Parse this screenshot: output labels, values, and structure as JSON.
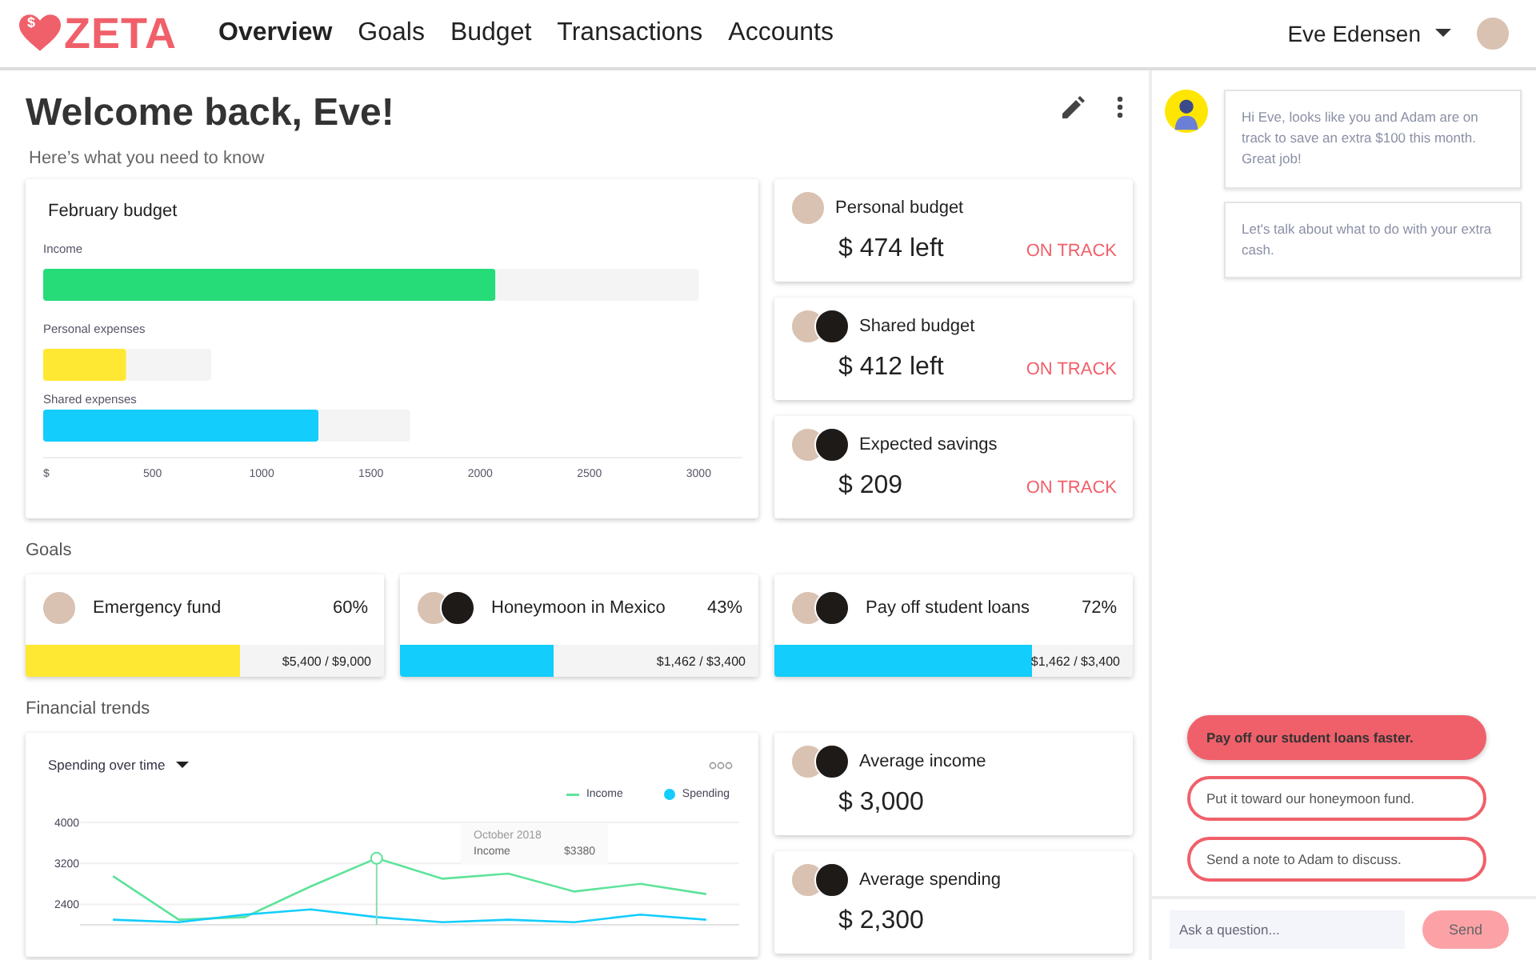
{
  "header": {
    "logo": {
      "badge": "$",
      "name": "ZETA"
    },
    "tabs": [
      {
        "label": "Overview",
        "selected": true
      },
      {
        "label": "Goals",
        "selected": false
      },
      {
        "label": "Budget",
        "selected": false
      },
      {
        "label": "Transactions",
        "selected": false
      },
      {
        "label": "Accounts",
        "selected": false
      }
    ],
    "user": {
      "name": "Eve Edensen"
    }
  },
  "welcome": {
    "title": "Welcome back, Eve!",
    "subtitle": "Here’s what you need to know"
  },
  "budget": {
    "title": "February budget",
    "chart_data": {
      "type": "bar",
      "orientation": "horizontal",
      "stacked": true,
      "series": [
        {
          "name": "Income",
          "color": "#25dc78",
          "values": [
            2070,
            null,
            null
          ]
        },
        {
          "name": "Personal expenses",
          "color": "#ffe833",
          "values": [
            null,
            380,
            null
          ]
        },
        {
          "name": "Shared expenses",
          "color": "#13cdfc",
          "values": [
            null,
            null,
            1260
          ]
        },
        {
          "color": "#f4f4f4",
          "values": [
            930,
            390,
            420
          ]
        }
      ],
      "xlim": [
        0,
        3200
      ],
      "xticks": [
        {
          "value": 0,
          "label": "$"
        },
        500,
        1000,
        1500,
        2000,
        2500,
        3000
      ]
    }
  },
  "summaries": [
    {
      "avatars": [
        {
          "kind": "light"
        }
      ],
      "title": "Personal budget",
      "amount": "$ 474 left",
      "status": "ON TRACK"
    },
    {
      "avatars": [
        {
          "kind": "light"
        },
        {
          "kind": "dark"
        }
      ],
      "title": "Shared budget",
      "amount": "$ 412 left",
      "status": "ON TRACK"
    },
    {
      "avatars": [
        {
          "kind": "light"
        },
        {
          "kind": "dark"
        }
      ],
      "title": "Expected savings",
      "amount": "$ 209",
      "status": "ON TRACK"
    }
  ],
  "goals": {
    "heading": "Goals",
    "items": [
      {
        "avatars": [
          {
            "kind": "light"
          }
        ],
        "title": "Emergency fund",
        "percent": "60%",
        "level": 0.6,
        "color": "#ffe833",
        "amount": "$5,400 / $9,000"
      },
      {
        "avatars": [
          {
            "kind": "light"
          },
          {
            "kind": "dark"
          }
        ],
        "title": "Honeymoon in Mexico",
        "percent": "43%",
        "level": 0.43,
        "color": "#13cdfc",
        "amount": "$1,462 / $3,400"
      },
      {
        "avatars": [
          {
            "kind": "light"
          },
          {
            "kind": "dark"
          }
        ],
        "title": "Pay off student loans",
        "percent": "72%",
        "level": 0.72,
        "color": "#13cdfc",
        "amount": "$1,462 / $3,400"
      }
    ]
  },
  "trends": {
    "heading": "Financial trends",
    "chart": {
      "title": "Spending over time",
      "chart_data": {
        "type": "line",
        "grid": true,
        "series": [
          {
            "name": "Income",
            "color": "#5ee39a",
            "values": [
              2950,
              2100,
              2150,
              2750,
              3300,
              2900,
              3000,
              2650,
              2800,
              2600
            ]
          },
          {
            "name": "Spending",
            "color": "#13cdfc",
            "values": [
              2100,
              2050,
              2200,
              2300,
              2150,
              2050,
              2100,
              2050,
              2200,
              2100
            ]
          }
        ],
        "ylim": [
          2000,
          4000
        ],
        "yticks": [
          2400,
          3200,
          4000
        ]
      },
      "tooltip": {
        "title": "October 2018",
        "label": "Income",
        "value": "$3380"
      }
    },
    "summaries": [
      {
        "avatars": [
          {
            "kind": "light"
          },
          {
            "kind": "dark"
          }
        ],
        "title": "Average income",
        "amount": "$ 3,000"
      },
      {
        "avatars": [
          {
            "kind": "light"
          },
          {
            "kind": "dark"
          }
        ],
        "title": "Average spending",
        "amount": "$ 2,300"
      }
    ]
  },
  "chat": {
    "messages": [
      "Hi Eve, looks like you and Adam are on track to save an extra $100 this month. Great job!",
      "Let's talk about what to do with your extra cash."
    ],
    "suggestions": [
      {
        "text": "Pay off our student loans faster.",
        "selected": true
      },
      {
        "text": "Put it toward our honeymoon fund.",
        "selected": false
      },
      {
        "text": "Send a note to Adam to discuss.",
        "selected": false
      }
    ],
    "input": {
      "placeholder": "Ask a question..."
    },
    "send": "Send"
  }
}
